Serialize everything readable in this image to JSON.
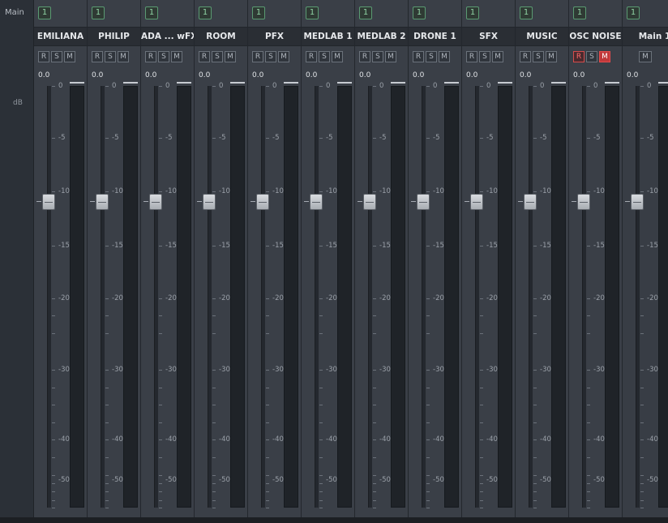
{
  "left_panel": {
    "bus_label": "Main",
    "unit_label": "dB"
  },
  "strips": [
    {
      "io": "1",
      "name": "EMILIANA",
      "buttons": [
        "R",
        "S",
        "M"
      ],
      "level": "0.0",
      "armed": false,
      "muted": false
    },
    {
      "io": "1",
      "name": "PHILIP",
      "buttons": [
        "R",
        "S",
        "M"
      ],
      "level": "0.0",
      "armed": false,
      "muted": false
    },
    {
      "io": "1",
      "name": "ADA ... wFX",
      "buttons": [
        "R",
        "S",
        "M"
      ],
      "level": "0.0",
      "armed": false,
      "muted": false
    },
    {
      "io": "1",
      "name": "ROOM",
      "buttons": [
        "R",
        "S",
        "M"
      ],
      "level": "0.0",
      "armed": false,
      "muted": false
    },
    {
      "io": "1",
      "name": "PFX",
      "buttons": [
        "R",
        "S",
        "M"
      ],
      "level": "0.0",
      "armed": false,
      "muted": false
    },
    {
      "io": "1",
      "name": "MEDLAB 1",
      "buttons": [
        "R",
        "S",
        "M"
      ],
      "level": "0.0",
      "armed": false,
      "muted": false
    },
    {
      "io": "1",
      "name": "MEDLAB 2",
      "buttons": [
        "R",
        "S",
        "M"
      ],
      "level": "0.0",
      "armed": false,
      "muted": false
    },
    {
      "io": "1",
      "name": "DRONE 1",
      "buttons": [
        "R",
        "S",
        "M"
      ],
      "level": "0.0",
      "armed": false,
      "muted": false
    },
    {
      "io": "1",
      "name": "SFX",
      "buttons": [
        "R",
        "S",
        "M"
      ],
      "level": "0.0",
      "armed": false,
      "muted": false
    },
    {
      "io": "1",
      "name": "MUSIC",
      "buttons": [
        "R",
        "S",
        "M"
      ],
      "level": "0.0",
      "armed": false,
      "muted": false
    },
    {
      "io": "1",
      "name": "OSC NOISE",
      "buttons": [
        "R",
        "S",
        "M"
      ],
      "level": "0.0",
      "armed": true,
      "muted": true
    },
    {
      "io": "1",
      "name": "Main 1",
      "buttons": [
        "M"
      ],
      "level": "0.0",
      "armed": false,
      "muted": false,
      "is_main": true
    }
  ],
  "scale_labels": [
    "0",
    "-5",
    "-10",
    "-15",
    "-20",
    "-30",
    "-40",
    "-50"
  ],
  "colors": {
    "io_badge": "#8fd3a4",
    "armed_red": "#d64b4b",
    "mute_active": "#c0393b"
  }
}
